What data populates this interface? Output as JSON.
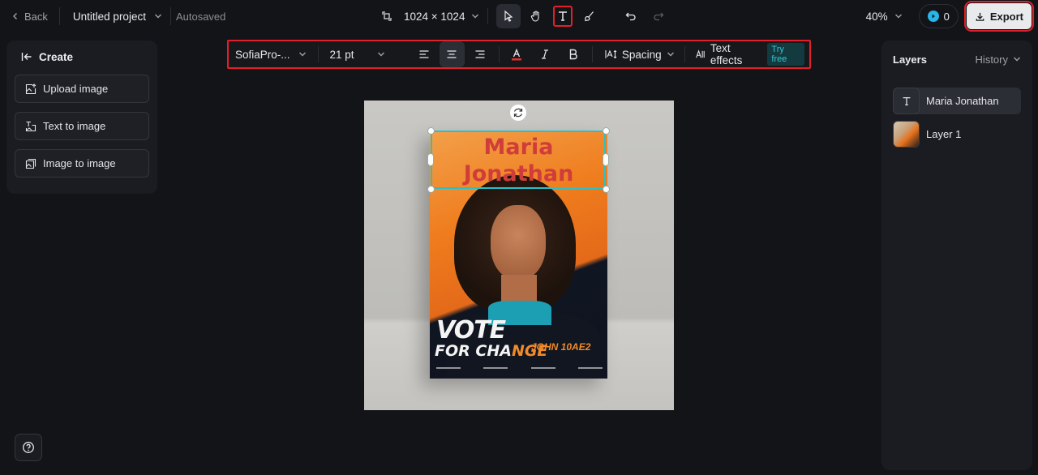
{
  "topbar": {
    "back_label": "Back",
    "project_title": "Untitled project",
    "autosave_status": "Autosaved",
    "canvas_size": "1024 × 1024",
    "zoom": "40%",
    "credits": "0",
    "export_label": "Export"
  },
  "format_toolbar": {
    "font": "SofiaPro-...",
    "font_size": "21 pt",
    "text_color": "#e0302e",
    "spacing_label": "Spacing",
    "effects_label": "Text effects",
    "try_free": "Try free"
  },
  "left_panel": {
    "create_label": "Create",
    "buttons": [
      {
        "label": "Upload image",
        "icon": "upload-image-icon"
      },
      {
        "label": "Text to image",
        "icon": "text-to-image-icon"
      },
      {
        "label": "Image to image",
        "icon": "image-to-image-icon"
      }
    ]
  },
  "right_panel": {
    "title": "Layers",
    "history_label": "History",
    "layers": [
      {
        "name": "Maria Jonathan",
        "type": "text",
        "selected": true
      },
      {
        "name": "Layer 1",
        "type": "image",
        "selected": false
      }
    ]
  },
  "canvas": {
    "text_layer_content": "Maria Jonathan",
    "poster_headline_1": "VOTE",
    "poster_headline_2a": "FOR CHA",
    "poster_headline_2b": "NGE",
    "poster_sub": "JOHN 10AE2"
  },
  "colors": {
    "accent": "#27c2c9",
    "highlight": "#e0202a",
    "background": "#131418"
  }
}
